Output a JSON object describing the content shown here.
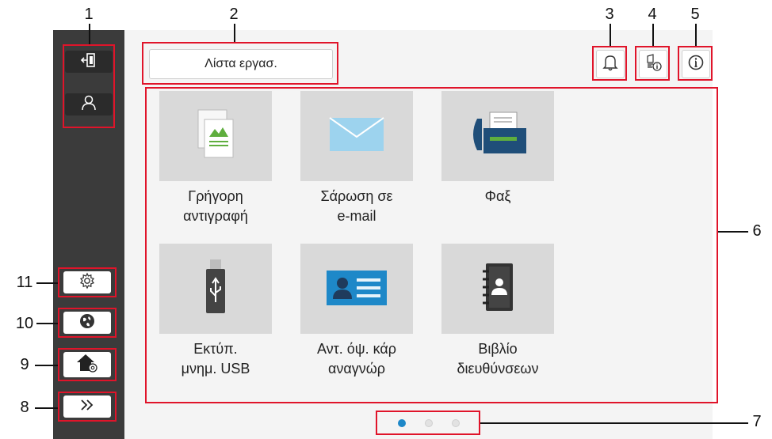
{
  "callouts": [
    "1",
    "2",
    "3",
    "4",
    "5",
    "6",
    "7",
    "8",
    "9",
    "10",
    "11"
  ],
  "header": {
    "job_list_label": "Λίστα εργασ."
  },
  "icons": {
    "logout": "logout-icon",
    "user": "user-icon",
    "settings": "gear-icon",
    "language": "globe-icon",
    "home_settings": "home-settings-icon",
    "expand": "chevron-double-right-icon",
    "bell": "bell-icon",
    "device_info": "device-info-icon",
    "info": "info-icon"
  },
  "tiles": [
    {
      "label1": "Γρήγορη",
      "label2": "αντιγραφή",
      "icon": "copy-icon"
    },
    {
      "label1": "Σάρωση σε",
      "label2": "e-mail",
      "icon": "envelope-icon"
    },
    {
      "label1": "Φαξ",
      "label2": "",
      "icon": "fax-icon"
    },
    {
      "label1": "Εκτύπ.",
      "label2": "μνημ. USB",
      "icon": "usb-icon"
    },
    {
      "label1": "Αντ. όψ. κάρ",
      "label2": "αναγνώρ",
      "icon": "id-card-icon"
    },
    {
      "label1": "Βιβλίο",
      "label2": "διευθύνσεων",
      "icon": "address-book-icon"
    }
  ],
  "pagination": {
    "pages": 3,
    "current": 1
  },
  "colors": {
    "highlight": "#e0142a",
    "sidebar": "#3b3b3b",
    "accent_blue": "#1e88c8",
    "tile_bg": "#d9d9d9"
  }
}
